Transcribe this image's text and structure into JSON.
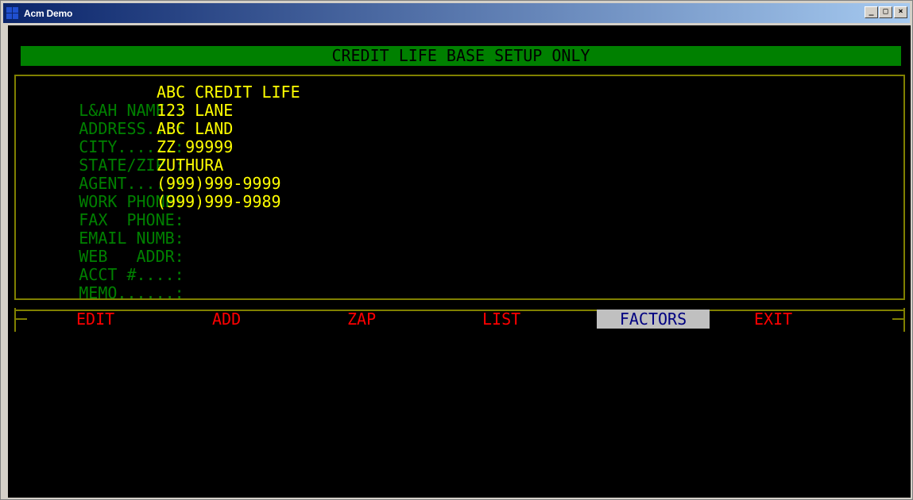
{
  "window": {
    "title": "Acm Demo",
    "minimize_label": "_",
    "maximize_label": "□",
    "close_label": "×"
  },
  "screen": {
    "header": "CREDIT LIFE BASE SETUP ONLY",
    "fields": [
      {
        "label": "L&AH NAME.:",
        "value": "ABC CREDIT LIFE"
      },
      {
        "label": "ADDRESS...:",
        "value": "123 LANE"
      },
      {
        "label": "CITY......:",
        "value": "ABC LAND"
      },
      {
        "label": "STATE/ZIP.:",
        "value": "ZZ 99999"
      },
      {
        "label": "AGENT.....:",
        "value": "ZUTHURA"
      },
      {
        "label": "WORK PHONE:",
        "value": "(999)999-9999"
      },
      {
        "label": "FAX  PHONE:",
        "value": "(999)999-9989"
      },
      {
        "label": "EMAIL NUMB:",
        "value": ""
      },
      {
        "label": "WEB   ADDR:",
        "value": ""
      },
      {
        "label": "ACCT #....:",
        "value": ""
      },
      {
        "label": "MEMO......:",
        "value": ""
      }
    ],
    "menu": [
      {
        "label": "EDIT"
      },
      {
        "label": "ADD"
      },
      {
        "label": "ZAP"
      },
      {
        "label": "LIST"
      },
      {
        "label": "FACTORS"
      },
      {
        "label": "EXIT"
      }
    ],
    "selected_menu": "FACTORS"
  },
  "colors": {
    "background": "#000000",
    "label": "#008000",
    "value": "#ffff00",
    "menu": "#ff0000",
    "menu_selected_bg": "#c0c0c0",
    "menu_selected_fg": "#000080",
    "frame": "#808000",
    "header_bg": "#008000"
  }
}
